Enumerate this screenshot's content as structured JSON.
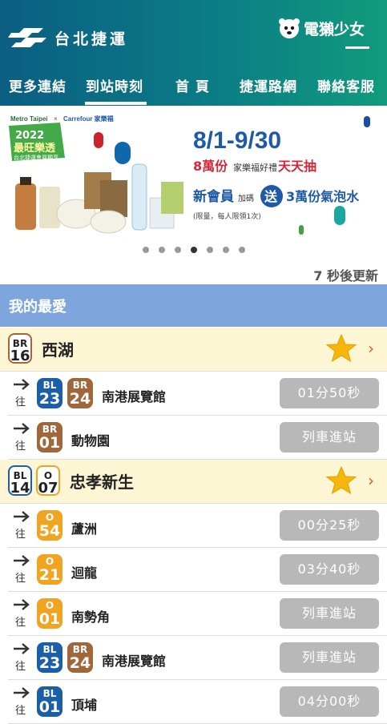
{
  "header": {
    "logo_text": "台北捷運",
    "brand_text": "電獺少女",
    "tabs": [
      "更多連結",
      "到站時刻",
      "首 頁",
      "捷運路網",
      "聯絡客服"
    ],
    "active_tab": "到站時刻",
    "colors": {
      "start": "#0b5e82",
      "end": "#119b7c"
    }
  },
  "banner": {
    "partner_left": "Metro Taipei",
    "partner_x": "×",
    "partner_right": "Carrefour 家樂福",
    "year": "2022",
    "campaign_line1": "最旺樂透",
    "campaign_line2": "台北捷運會員獨享",
    "dates": "8/1-9/30",
    "line1_a": "8萬份",
    "line1_b": "家樂福好禮",
    "line1_c": "天天抽",
    "line2_a": "新會員",
    "line2_b": "加碼",
    "line2_c": "送",
    "line2_d": "3萬份氣泡水",
    "note": "(限量，每人限領1次)",
    "dots": 7,
    "active_dot": 4
  },
  "update_text": "7 秒後更新",
  "favorites": {
    "title": "我的最愛",
    "direction_label": "往",
    "stations": [
      {
        "name": "西湖",
        "badges": [
          {
            "code": "BR",
            "num": "16",
            "color": "#a0683a"
          }
        ],
        "arrivals": [
          {
            "badges": [
              {
                "code": "BL",
                "num": "23",
                "color": "#1a5fa8"
              },
              {
                "code": "BR",
                "num": "24",
                "color": "#a0683a"
              }
            ],
            "dest": "南港展覽館",
            "time": "01分50秒"
          },
          {
            "badges": [
              {
                "code": "BR",
                "num": "01",
                "color": "#a0683a"
              }
            ],
            "dest": "動物園",
            "time": "列車進站"
          }
        ]
      },
      {
        "name": "忠孝新生",
        "badges": [
          {
            "code": "BL",
            "num": "14",
            "color": "#1a5fa8"
          },
          {
            "code": "O",
            "num": "07",
            "color": "#f1a420"
          }
        ],
        "arrivals": [
          {
            "badges": [
              {
                "code": "O",
                "num": "54",
                "color": "#f1a420"
              }
            ],
            "dest": "蘆洲",
            "time": "00分25秒"
          },
          {
            "badges": [
              {
                "code": "O",
                "num": "21",
                "color": "#f1a420"
              }
            ],
            "dest": "迴龍",
            "time": "03分40秒"
          },
          {
            "badges": [
              {
                "code": "O",
                "num": "01",
                "color": "#f1a420"
              }
            ],
            "dest": "南勢角",
            "time": "列車進站"
          },
          {
            "badges": [
              {
                "code": "BL",
                "num": "23",
                "color": "#1a5fa8"
              },
              {
                "code": "BR",
                "num": "24",
                "color": "#a0683a"
              }
            ],
            "dest": "南港展覽館",
            "time": "列車進站"
          },
          {
            "badges": [
              {
                "code": "BL",
                "num": "01",
                "color": "#1a5fa8"
              }
            ],
            "dest": "頂埔",
            "time": "04分00秒"
          }
        ]
      }
    ]
  }
}
